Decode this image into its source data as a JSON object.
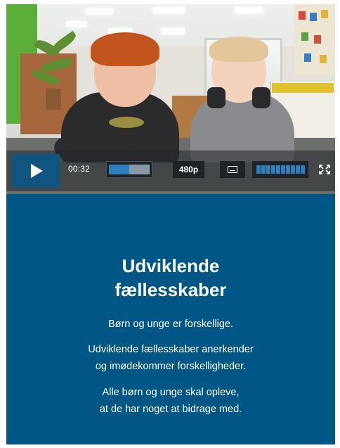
{
  "video": {
    "time": "00:32",
    "progress": 0.5,
    "quality": "480p",
    "volume_level": 1.0,
    "play_icon": "play-icon",
    "captions_icon": "captions-icon",
    "fullscreen_icon": "fullscreen-icon"
  },
  "content": {
    "title_line1": "Udviklende",
    "title_line2": "fællesskaber",
    "line1": "Børn og unge er forskellige.",
    "line2a": "Udviklende fællesskaber anerkender",
    "line2b": "og imødekommer forskelligheder.",
    "line3a": "Alle børn og unge skal opleve,",
    "line3b": "at de har noget at bidrage med."
  },
  "colors": {
    "panel_background": "#005684",
    "play_button": "#10557f",
    "accent": "#2f7fbf"
  }
}
